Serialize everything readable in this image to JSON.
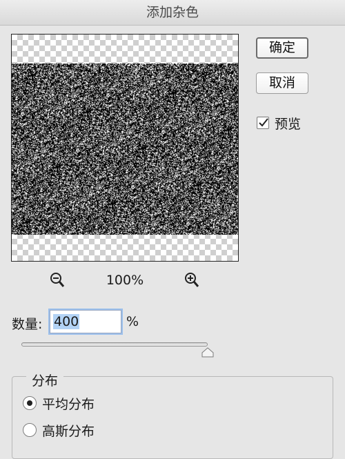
{
  "window": {
    "title": "添加杂色"
  },
  "buttons": {
    "ok": "确定",
    "cancel": "取消"
  },
  "preview_checkbox": {
    "label": "预览",
    "checked": true
  },
  "zoom": {
    "level": "100%"
  },
  "amount": {
    "label": "数量:",
    "value": "400",
    "unit": "%",
    "slider_fraction": 1.0
  },
  "distribution": {
    "title": "分布",
    "options": [
      {
        "label": "平均分布",
        "selected": true
      },
      {
        "label": "高斯分布",
        "selected": false
      }
    ]
  }
}
